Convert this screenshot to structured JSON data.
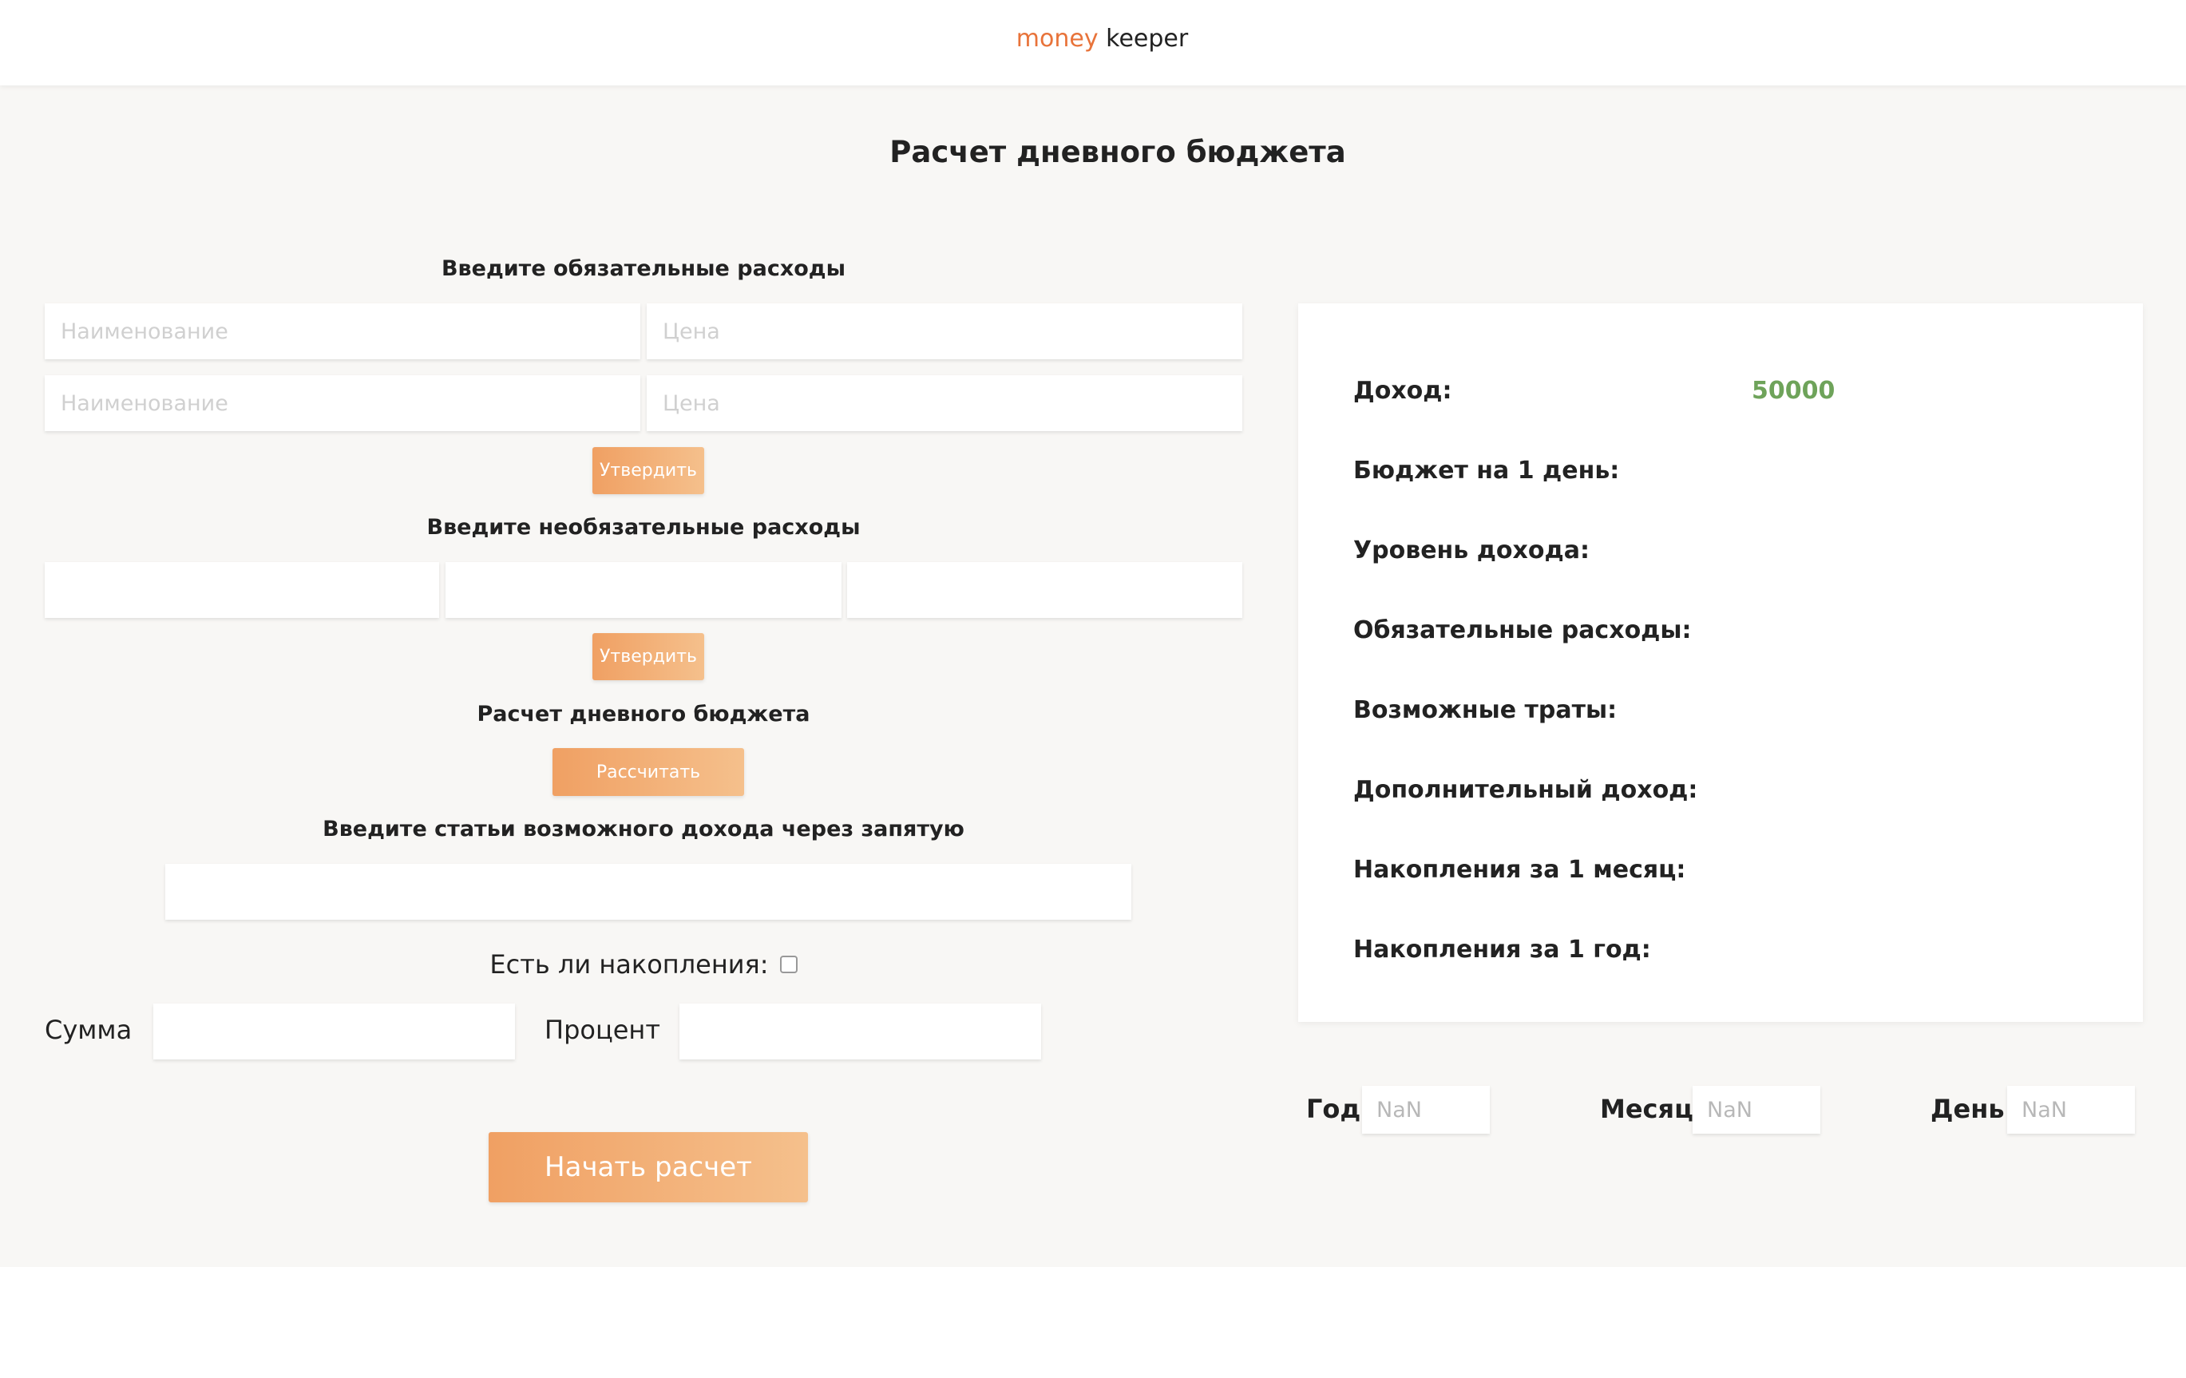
{
  "header": {
    "logo_accent": "money",
    "logo_rest": "keeper"
  },
  "page": {
    "title": "Расчет дневного бюджета"
  },
  "mandatory": {
    "label": "Введите обязательные расходы",
    "name_placeholder": "Наименование",
    "price_placeholder": "Цена",
    "confirm_label": "Утвердить"
  },
  "optional": {
    "label": "Введите необязательные расходы",
    "confirm_label": "Утвердить"
  },
  "calc": {
    "label": "Расчет дневного бюджета",
    "button_label": "Рассчитать"
  },
  "income_items": {
    "label": "Введите статьи возможного дохода через запятую"
  },
  "savings": {
    "label": "Есть ли накопления:",
    "checked": false,
    "sum_label": "Сумма",
    "percent_label": "Процент"
  },
  "start": {
    "button_label": "Начать расчет"
  },
  "results": {
    "income_label": "Доход:",
    "income_value": "50000",
    "daily_budget_label": "Бюджет на 1 день:",
    "income_level_label": "Уровень дохода:",
    "mandatory_expenses_label": "Обязательные расходы:",
    "possible_spending_label": "Возможные траты:",
    "additional_income_label": "Дополнительный доход:",
    "savings_month_label": "Накопления за 1 месяц:",
    "savings_year_label": "Накопления за 1 год:"
  },
  "date": {
    "year_label": "Год:",
    "year_placeholder": "NaN",
    "month_label": "Месяц:",
    "month_placeholder": "NaN",
    "day_label": "День:",
    "day_placeholder": "NaN"
  },
  "colors": {
    "accent": "#e8733a",
    "button_gradient_start": "#f0a063",
    "button_gradient_end": "#f5c08c",
    "income_value": "#6ea35a",
    "background": "#f8f7f5"
  }
}
